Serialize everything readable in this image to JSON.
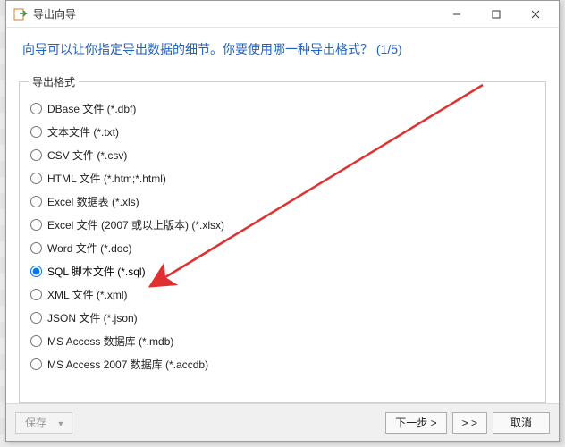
{
  "window": {
    "title": "导出向导",
    "min_icon": "minimize-icon",
    "max_icon": "maximize-icon",
    "close_icon": "close-icon"
  },
  "header": {
    "text": "向导可以让你指定导出数据的细节。你要使用哪一种导出格式？ (1/5)"
  },
  "group": {
    "legend": "导出格式",
    "options": [
      {
        "label": "DBase 文件 (*.dbf)"
      },
      {
        "label": "文本文件 (*.txt)"
      },
      {
        "label": "CSV 文件 (*.csv)"
      },
      {
        "label": "HTML 文件 (*.htm;*.html)"
      },
      {
        "label": "Excel 数据表 (*.xls)"
      },
      {
        "label": "Excel 文件 (2007 或以上版本) (*.xlsx)"
      },
      {
        "label": "Word 文件 (*.doc)"
      },
      {
        "label": "SQL 脚本文件 (*.sql)"
      },
      {
        "label": "XML 文件 (*.xml)"
      },
      {
        "label": "JSON 文件 (*.json)"
      },
      {
        "label": "MS Access 数据库 (*.mdb)"
      },
      {
        "label": "MS Access 2007 数据库 (*.accdb)"
      }
    ],
    "selected_index": 7
  },
  "footer": {
    "save": "保存",
    "save_dropdown_glyph": "▾",
    "next": "下一步 >",
    "skip": "> >",
    "cancel": "取消"
  }
}
